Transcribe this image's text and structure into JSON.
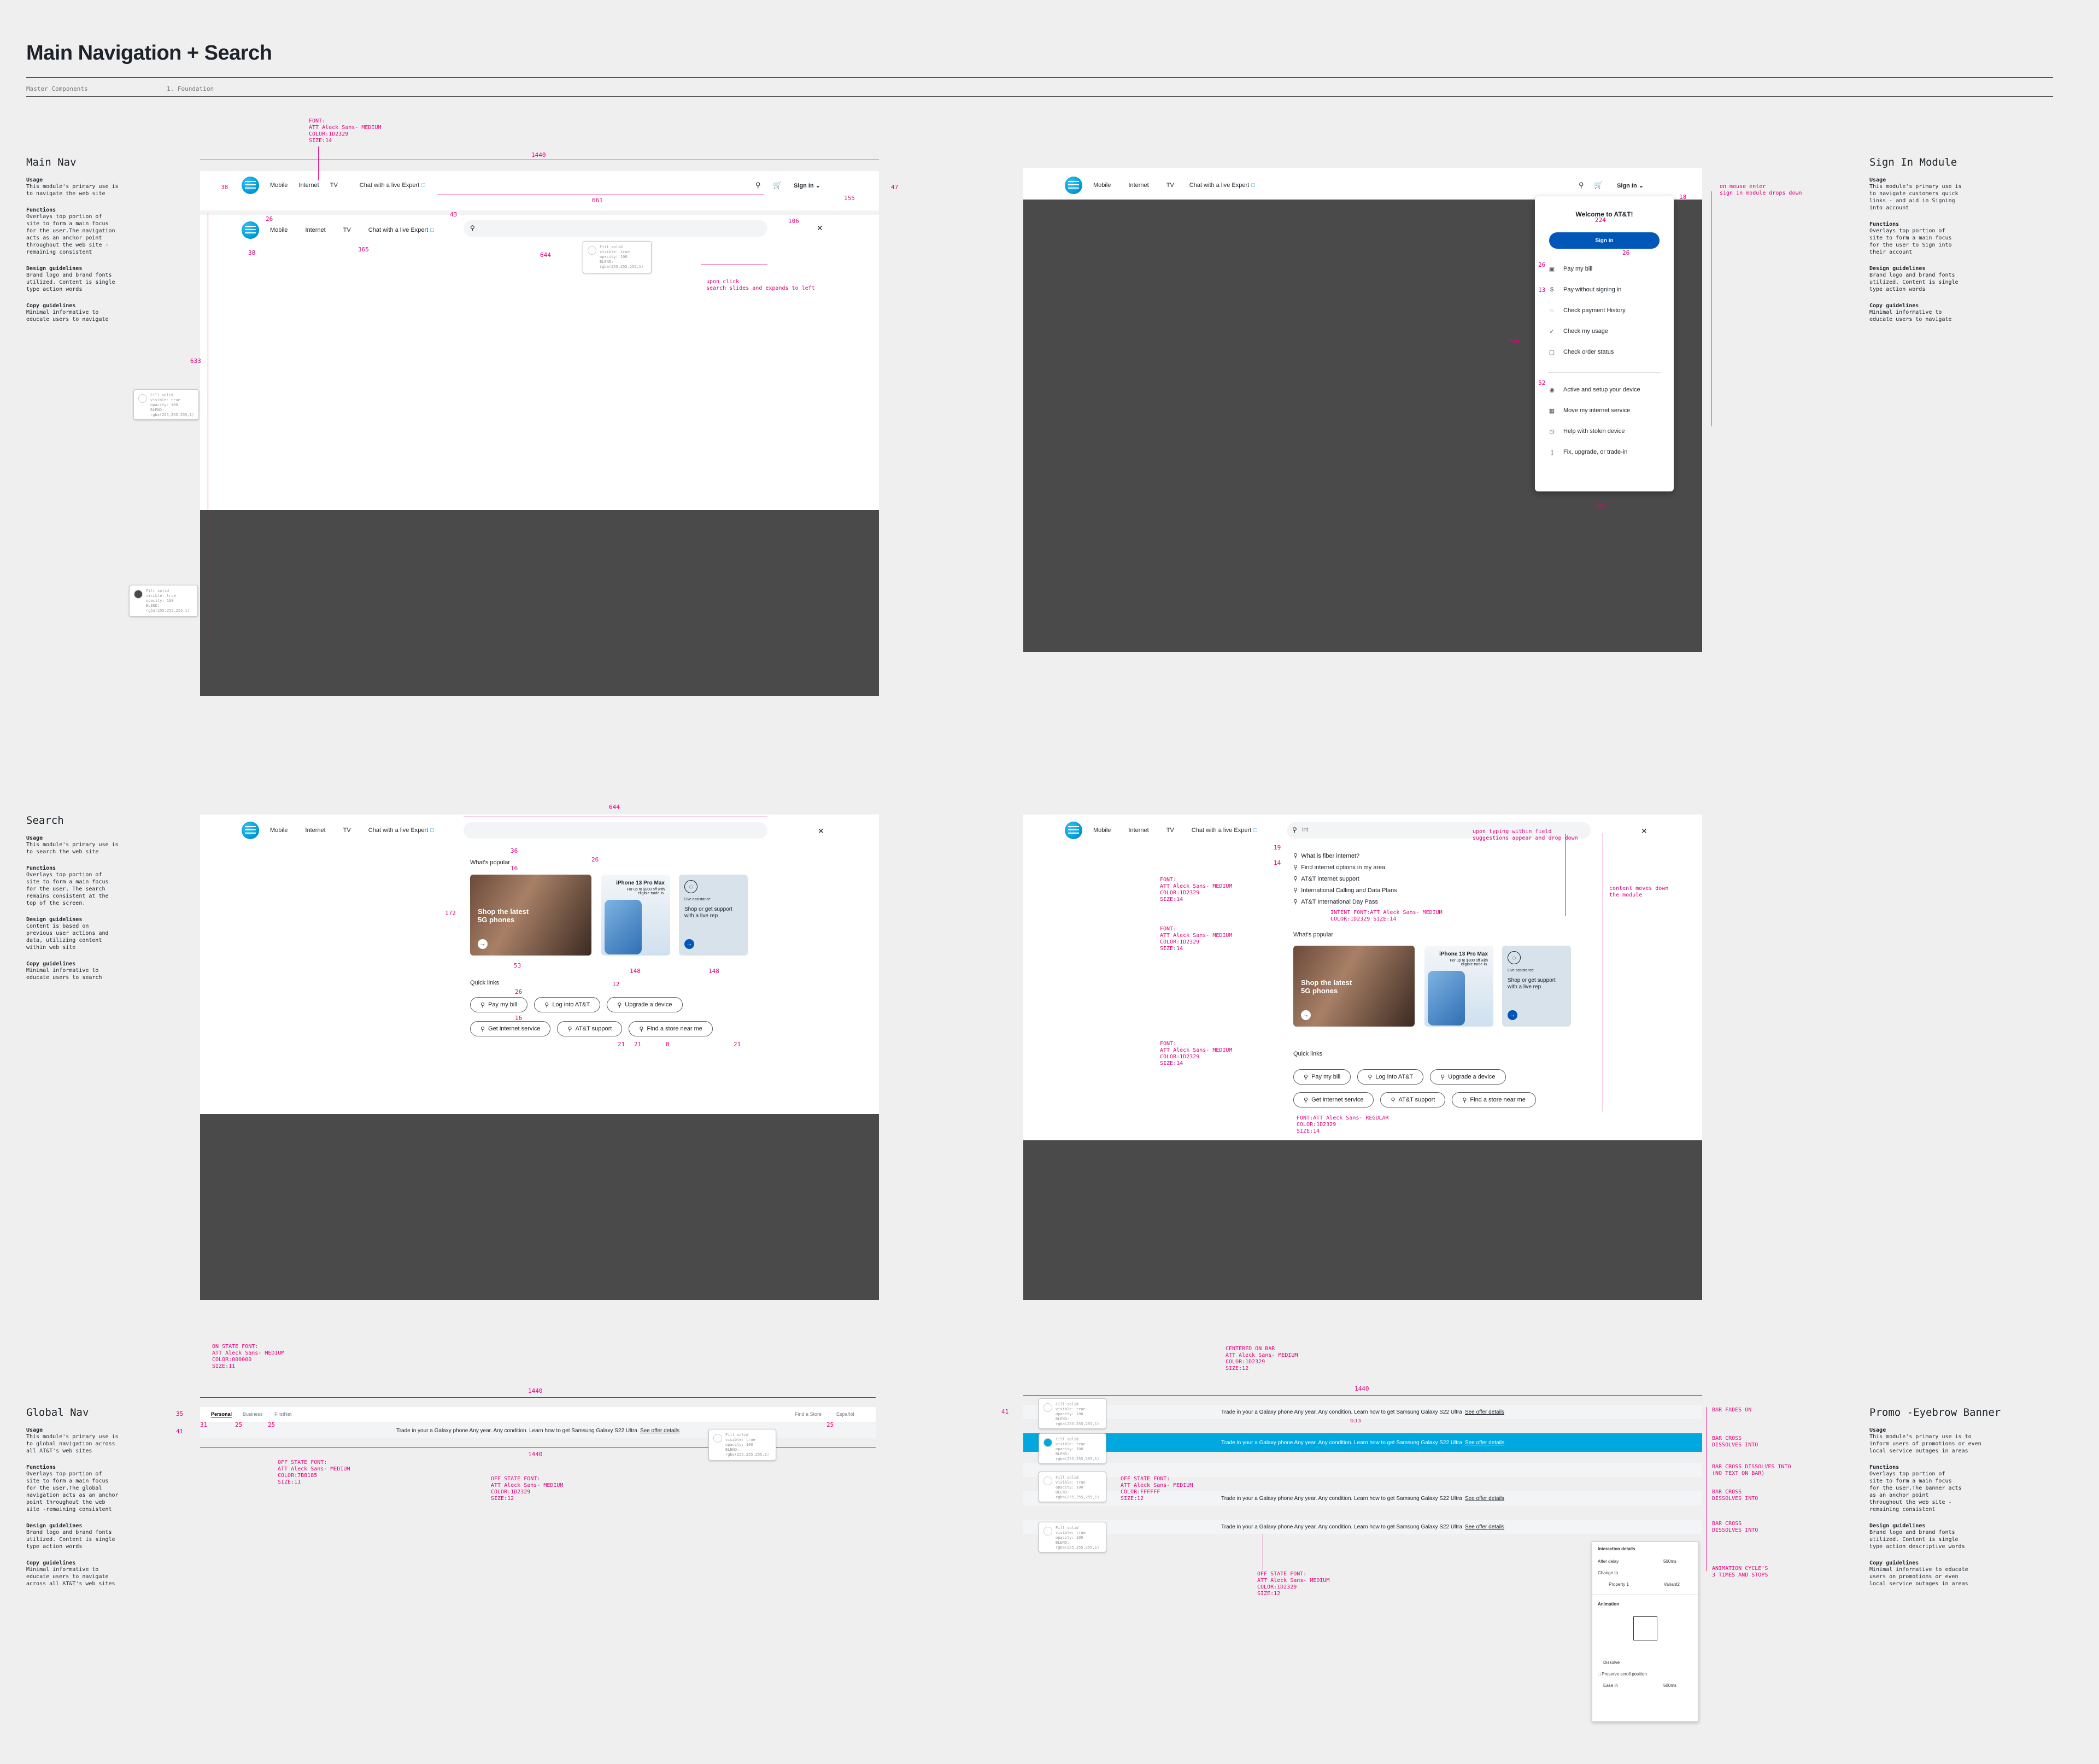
{
  "page": {
    "title": "Main Navigation + Search",
    "breadcrumb_left": "Master Components",
    "breadcrumb_right": "1. Foundation"
  },
  "colors": {
    "pink_annotation": "#e5007e",
    "att_blue": "#009fdb",
    "signin_blue": "#0057b8",
    "overlay": "#4a4a4a",
    "banner_active": "#00a8e0",
    "text": "#1d2329"
  },
  "nav": {
    "mobile": "Mobile",
    "internet": "Internet",
    "tv": "TV",
    "chat": "Chat with a live Expert",
    "sign_in": "Sign In",
    "search_icon": "search-icon",
    "cart_icon": "cart-icon",
    "close_icon": "close-icon"
  },
  "left_labels": {
    "main_nav": {
      "title": "Main Nav",
      "usage_h": "Usage",
      "usage": "This module's primary use is\nto navigate the web site",
      "functions_h": "Functions",
      "functions": "Overlays top portion of\nsite to form a main focus\nfor the user.The navigation\nacts as an anchor point\nthroughout the web site -\nremaining consistent",
      "design_h": "Design guidelines",
      "design": "Brand logo and brand fonts\nutilized. Content is single\ntype action words",
      "copy_h": "Copy guidelines",
      "copy": "Minimal informative to\neducate users to navigate"
    },
    "search": {
      "title": "Search",
      "usage_h": "Usage",
      "usage": "This module's primary use is\nto search the web site",
      "functions_h": "Functions",
      "functions": "Overlays top portion of\nsite to form a main focus\nfor the user. The search\nremains consistent at the\ntop of the screen.",
      "design_h": "Design guidelines",
      "design": "Content is based on\nprevious user actions and\ndata, utilizing content\nwithin web site",
      "copy_h": "Copy guidelines",
      "copy": "Minimal informative to\neducate users to search"
    },
    "global_nav": {
      "title": "Global Nav",
      "usage_h": "Usage",
      "usage": "This module's primary use is\nto global navigation across\nall AT&T's web sites",
      "functions_h": "Functions",
      "functions": "Overlays top portion of\nsite to form a main focus\nfor the user.The global\nnavigation acts as an anchor\npoint throughout the web\nsite -remaining consistent",
      "design_h": "Design guidelines",
      "design": "Brand logo and brand fonts\nutilized. Content is single\ntype action words",
      "copy_h": "Copy guidelines",
      "copy": "Minimal informative to\neducate users to navigate\nacross all AT&T's web sites"
    }
  },
  "right_labels": {
    "signin": {
      "title": "Sign In Module",
      "usage_h": "Usage",
      "usage": "This module's primary use is\nto navigate customers quick\nlinks - and aid in Signing\ninto account",
      "functions_h": "Functions",
      "functions": "Overlays top portion of\nsite to form a main focus\nfor the user to Sign into\ntheir account",
      "design_h": "Design guidelines",
      "design": "Brand logo and brand fonts\nutilized. Content is single\ntype action words",
      "copy_h": "Copy guidelines",
      "copy": "Minimal informative to\neducate users to navigate"
    },
    "promo": {
      "title": "Promo -Eyebrow Banner",
      "usage_h": "Usage",
      "usage": "This module's primary use is to\ninform users of promotions or even\nlocal service outages in areas",
      "functions_h": "Functions",
      "functions": "Overlays top portion of\nsite to form a main focus\nfor the user.The banner acts\nas an anchor point\nthroughout the web site -\nremaining consistent",
      "design_h": "Design guidelines",
      "design": "Brand logo and brand fonts\nutilized. Content is single\ntype action descriptive words",
      "copy_h": "Copy guidelines",
      "copy": "Minimal informative to educate\nusers on promotions or even\nlocal service outages in areas"
    }
  },
  "annotations": {
    "font_main": "FONT:\nATT Aleck Sans- MEDIUM\nCOLOR:1D2329\nSIZE:14",
    "width_1440": "1440",
    "upon_click": "upon click\nsearch slides and expands to left",
    "on_mouse_enter": "on mouse enter\nsign in module drops down",
    "upon_typing": "upon typing within field\nsuggestions appear and drop down",
    "content_moves": "content moves down\nthe module",
    "intent_font": "INTENT FONT:ATT Aleck Sans- MEDIUM\nCOLOR:1D2329  SIZE:14",
    "regular_font": "FONT:ATT Aleck Sans- REGULAR\nCOLOR:1D2329\nSIZE:14",
    "on_state_font": "ON STATE FONT:\nATT Aleck Sans- MEDIUM\nCOLOR:000000\nSIZE:11",
    "off_state_font_11": "OFF STATE FONT:\nATT Aleck Sans- MEDIUM\nCOLOR:7B8185\nSIZE:11",
    "off_state_font_12": "OFF STATE FONT:\nATT Aleck Sans- MEDIUM\nCOLOR:1D2329\nSIZE:12",
    "centered_on_bar": "CENTERED ON BAR\nATT Aleck Sans- MEDIUM\nCOLOR:1D2329\nSIZE:12",
    "off_state_ffffff": "OFF STATE FONT:\nATT Aleck Sans- MEDIUM\nCOLOR:FFFFFF\nSIZE:12",
    "off_state_bottom": "OFF STATE FONT:\nATT Aleck Sans- MEDIUM\nCOLOR:1D2329\nSIZE:12",
    "bar_fades_on": "BAR FADES ON",
    "bar_cross_1": "BAR CROSS\nDISSOLVES INTO",
    "bar_cross_notext": "BAR CROSS DISSOLVES INTO\n(NO TEXT ON BAR)",
    "bar_cross_2": "BAR CROSS\nDISSOLVES INTO",
    "bar_cross_3": "BAR CROSS\nDISSOLVES INTO",
    "animation_cycle": "ANIMATION CYCLE'S\n3 TIMES AND STOPS",
    "fill_note": "Fill solid\nvisible: true\nopacity: 100\nBLEND:\nrgba(255,255,255,1)"
  },
  "signin_dropdown": {
    "welcome": "Welcome to AT&T!",
    "sign_in_button": "Sign in",
    "items": [
      {
        "label": "Pay my bill",
        "icon": "bill-icon"
      },
      {
        "label": "Pay without signing in",
        "icon": "dollar-icon"
      },
      {
        "label": "Check payment History",
        "icon": "history-icon"
      },
      {
        "label": "Check my usage",
        "icon": "usage-icon"
      },
      {
        "label": "Check order status",
        "icon": "order-icon"
      }
    ],
    "items2": [
      {
        "label": "Active and setup your device",
        "icon": "device-icon"
      },
      {
        "label": "Move my internet service",
        "icon": "move-icon"
      },
      {
        "label": "Help with stolen device",
        "icon": "help-icon"
      },
      {
        "label": "Fix, upgrade, or trade-in",
        "icon": "phone-icon"
      }
    ]
  },
  "search_panel": {
    "whats_popular": "What's popular",
    "card1_text": "Shop the latest\n5G phones",
    "card2_title": "iPhone 13 Pro Max",
    "card2_sub": "For up to $800 off with\neligible trade-in.",
    "card3_title": "Live assistance",
    "card3_sub": "Shop or get support\nwith a live rep",
    "quick_links": "Quick links",
    "links": [
      "Pay my bill",
      "Log into AT&T",
      "Upgrade a device",
      "Get internet service",
      "AT&T support",
      "Find a store near me"
    ],
    "typed": "int",
    "suggestions": [
      "What is fiber internet?",
      "Find internet options in my area",
      "AT&T internet support",
      "International Calling and Data Plans",
      "AT&T International Day Pass"
    ]
  },
  "global_nav": {
    "personal": "Personal",
    "business": "Business",
    "firstnet": "FirstNet",
    "find_store": "Find a Store",
    "espanol": "Español",
    "promo_text": "Trade in your a Galaxy phone Any year. Any condition. Learn how to get Samsung Galaxy S22 Ultra",
    "promo_link": "See offer details"
  },
  "interaction_panel": {
    "title": "Interaction details",
    "after_delay": "After delay",
    "delay_value": "500ms",
    "change_to": "Change to",
    "property": "Property 1",
    "variant": "Variant2",
    "animation": "Animation",
    "dissolve": "Dissolve",
    "preserve": "Preserve scroll position",
    "ease_in": "Ease in",
    "ease_value": "500ms"
  }
}
